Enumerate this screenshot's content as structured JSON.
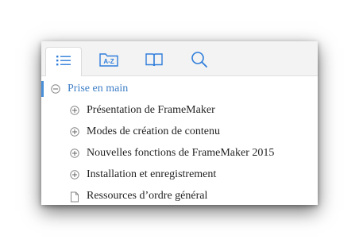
{
  "toolbar": {
    "tabs": [
      {
        "name": "contents",
        "icon": "list-icon",
        "active": true
      },
      {
        "name": "index",
        "icon": "a-z-icon",
        "label": "A-Z",
        "active": false
      },
      {
        "name": "glossary",
        "icon": "book-icon",
        "active": false
      },
      {
        "name": "search",
        "icon": "search-icon",
        "active": false
      }
    ]
  },
  "tree": {
    "root": {
      "label": "Prise en main",
      "state": "expanded"
    },
    "items": [
      {
        "label": "Présentation de FrameMaker",
        "type": "collapsed"
      },
      {
        "label": "Modes de création de contenu",
        "type": "collapsed"
      },
      {
        "label": "Nouvelles fonctions de FrameMaker 2015",
        "type": "collapsed"
      },
      {
        "label": "Installation et enregistrement",
        "type": "collapsed"
      },
      {
        "label": "Ressources d’ordre général",
        "type": "page"
      }
    ]
  },
  "colors": {
    "accent": "#4a90d9",
    "link": "#3f7fc6",
    "icon": "#2f7ddb"
  }
}
